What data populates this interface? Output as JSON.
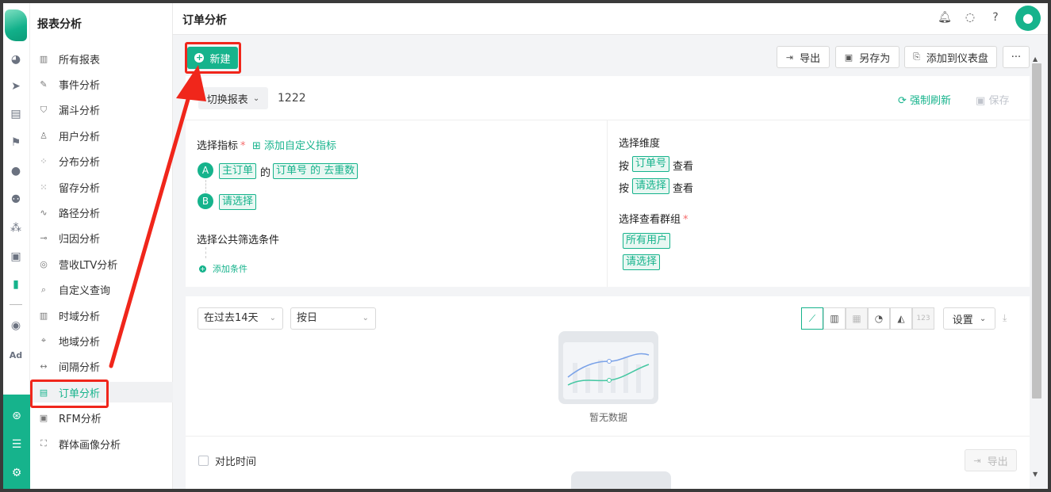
{
  "rail": {
    "icons": [
      "dashboard-icon",
      "send-icon",
      "layout-icon",
      "flag-icon",
      "user-icon",
      "users-icon",
      "cluster-icon",
      "bookmark-icon",
      "bar-chart-icon",
      "wechat-icon",
      "ad-icon"
    ],
    "ad_label": "Ad",
    "bottom_icons": [
      "radar-icon",
      "server-icon",
      "gear-icon"
    ]
  },
  "nav": {
    "title": "报表分析",
    "items": [
      {
        "label": "所有报表",
        "icon": "bar-chart-icon"
      },
      {
        "label": "事件分析",
        "icon": "edit-icon"
      },
      {
        "label": "漏斗分析",
        "icon": "funnel-icon"
      },
      {
        "label": "用户分析",
        "icon": "user-icon"
      },
      {
        "label": "分布分析",
        "icon": "distribution-icon"
      },
      {
        "label": "留存分析",
        "icon": "dots-icon"
      },
      {
        "label": "路径分析",
        "icon": "path-icon"
      },
      {
        "label": "归因分析",
        "icon": "attribution-icon"
      },
      {
        "label": "营收LTV分析",
        "icon": "coin-icon"
      },
      {
        "label": "自定义查询",
        "icon": "query-icon"
      },
      {
        "label": "时域分析",
        "icon": "time-bar-icon"
      },
      {
        "label": "地域分析",
        "icon": "location-icon"
      },
      {
        "label": "间隔分析",
        "icon": "interval-icon"
      },
      {
        "label": "订单分析",
        "icon": "order-icon",
        "active": true
      },
      {
        "label": "RFM分析",
        "icon": "rfm-icon"
      },
      {
        "label": "群体画像分析",
        "icon": "portrait-icon"
      }
    ]
  },
  "topbar": {
    "title": "订单分析",
    "icons": [
      "bell-icon",
      "chat-icon",
      "help-icon"
    ],
    "avatar_icon": "avatar-icon"
  },
  "toolbar": {
    "new_label": "新建",
    "export_label": "导出",
    "save_as_label": "另存为",
    "add_dashboard_label": "添加到仪表盘",
    "more_label": "···"
  },
  "report": {
    "switch_label": "切换报表",
    "name": "1222",
    "refresh_label": "强制刷新",
    "save_label": "保存",
    "metric_title": "选择指标",
    "add_custom_metric": "添加自定义指标",
    "metric_a": {
      "letter": "A",
      "subject": "主订单",
      "of": "的",
      "measure": "订单号 的 去重数"
    },
    "metric_b": {
      "letter": "B",
      "placeholder": "请选择"
    },
    "filter_title": "选择公共筛选条件",
    "add_condition": "添加条件",
    "dimension_title": "选择维度",
    "dim_rows": [
      {
        "prefix": "按",
        "tag": "订单号",
        "suffix": "查看"
      },
      {
        "prefix": "按",
        "tag": "请选择",
        "suffix": "查看"
      }
    ],
    "group_title": "选择查看群组",
    "groups": [
      "所有用户",
      "请选择"
    ]
  },
  "chart_panel": {
    "range_select": "在过去14天",
    "granularity_select": "按日",
    "chart_types": [
      "line-chart-icon",
      "bar-chart-icon",
      "stacked-bar-icon",
      "pie-chart-icon",
      "area-chart-icon",
      "number-icon"
    ],
    "number_label": "123",
    "settings_label": "设置",
    "empty_text": "暂无数据",
    "compare_label": "对比时间",
    "export_label": "导出"
  },
  "colors": {
    "accent": "#16b38c",
    "highlight": "#f0261b"
  }
}
